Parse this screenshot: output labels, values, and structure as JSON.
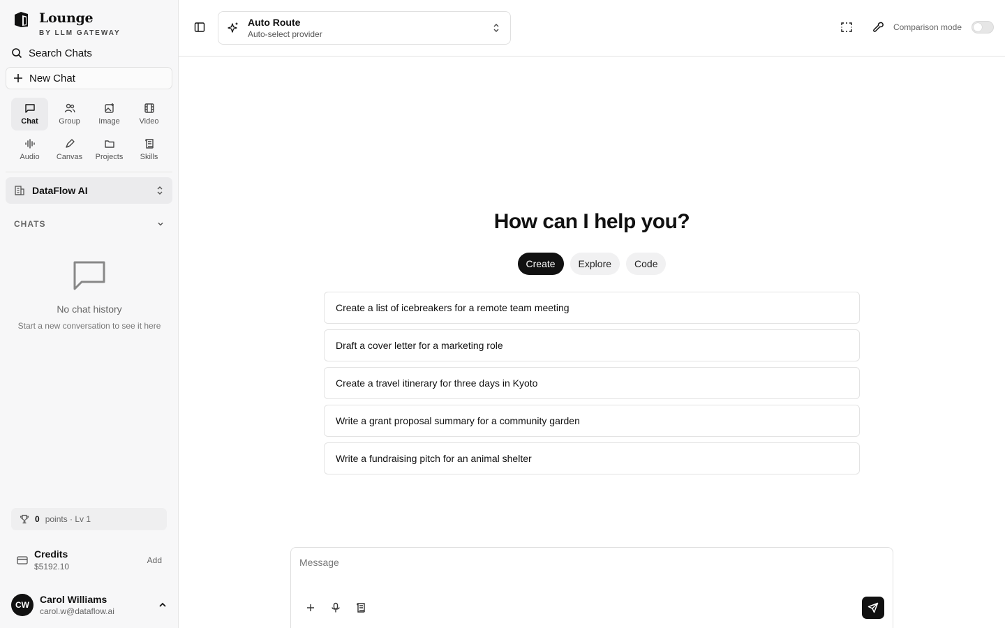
{
  "brand": {
    "name": "Lounge",
    "tagline": "BY LLM GATEWAY"
  },
  "sidebar": {
    "search_label": "Search Chats",
    "new_chat_label": "New Chat",
    "modes": [
      {
        "label": "Chat",
        "icon": "chat-icon",
        "active": true
      },
      {
        "label": "Group",
        "icon": "group-icon",
        "active": false
      },
      {
        "label": "Image",
        "icon": "image-icon",
        "active": false
      },
      {
        "label": "Video",
        "icon": "video-icon",
        "active": false
      },
      {
        "label": "Audio",
        "icon": "audio-icon",
        "active": false
      },
      {
        "label": "Canvas",
        "icon": "canvas-icon",
        "active": false
      },
      {
        "label": "Projects",
        "icon": "folder-icon",
        "active": false
      },
      {
        "label": "Skills",
        "icon": "skills-icon",
        "active": false
      }
    ],
    "org_name": "DataFlow AI",
    "chats_header": "CHATS",
    "empty_title": "No chat history",
    "empty_subtitle": "Start a new conversation to see it here",
    "points_value": "0",
    "points_label": "points · Lv 1",
    "credits_label": "Credits",
    "credits_amount": "$5192.10",
    "credits_add": "Add",
    "user": {
      "initials": "CW",
      "name": "Carol Williams",
      "email": "carol.w@dataflow.ai"
    }
  },
  "topbar": {
    "model_title": "Auto Route",
    "model_subtitle": "Auto-select provider",
    "comparison_label": "Comparison mode",
    "comparison_enabled": false
  },
  "main": {
    "heading": "How can I help you?",
    "tabs": [
      {
        "label": "Create",
        "active": true
      },
      {
        "label": "Explore",
        "active": false
      },
      {
        "label": "Code",
        "active": false
      }
    ],
    "suggestions": [
      "Create a list of icebreakers for a remote team meeting",
      "Draft a cover letter for a marketing role",
      "Create a travel itinerary for three days in Kyoto",
      "Write a grant proposal summary for a community garden",
      "Write a fundraising pitch for an animal shelter"
    ],
    "message_placeholder": "Message"
  },
  "colors": {
    "accent": "#111111",
    "sidebar_bg": "#f7f7f8",
    "border": "#e5e5e5"
  }
}
